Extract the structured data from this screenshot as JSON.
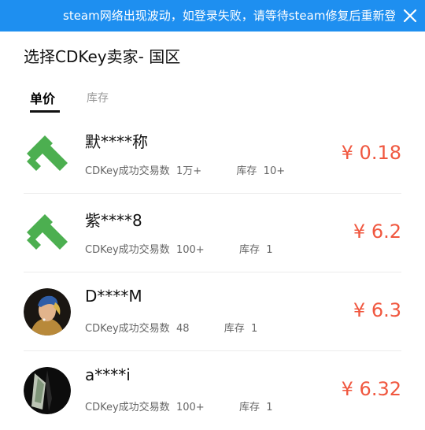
{
  "banner": {
    "text": "steam网络出现波动，如登录失败，请等待steam修复后重新登录。",
    "close_icon": "close-icon",
    "color": "#1e8ff0"
  },
  "page": {
    "title": "选择CDKey卖家- 国区"
  },
  "tabs": [
    {
      "label": "单价",
      "active": true
    },
    {
      "label": "库存",
      "active": false
    }
  ],
  "sellers": [
    {
      "name": "默****称",
      "trade_label": "CDKey成功交易数",
      "trades": "1万+",
      "stock_label": "库存",
      "stock": "10+",
      "price": "¥ 0.18",
      "avatar": "green-logo-avatar"
    },
    {
      "name": "紫****8",
      "trade_label": "CDKey成功交易数",
      "trades": "100+",
      "stock_label": "库存",
      "stock": "1",
      "price": "¥ 6.2",
      "avatar": "green-logo-avatar"
    },
    {
      "name": "D****M",
      "trade_label": "CDKey成功交易数",
      "trades": "48",
      "stock_label": "库存",
      "stock": "1",
      "price": "¥ 6.3",
      "avatar": "portrait-avatar"
    },
    {
      "name": "a****i",
      "trade_label": "CDKey成功交易数",
      "trades": "100+",
      "stock_label": "库存",
      "stock": "1",
      "price": "¥ 6.32",
      "avatar": "dark-photo-avatar"
    }
  ],
  "colors": {
    "accent": "#f0573f",
    "brand_green": "#4caf50",
    "banner": "#1e8ff0"
  }
}
